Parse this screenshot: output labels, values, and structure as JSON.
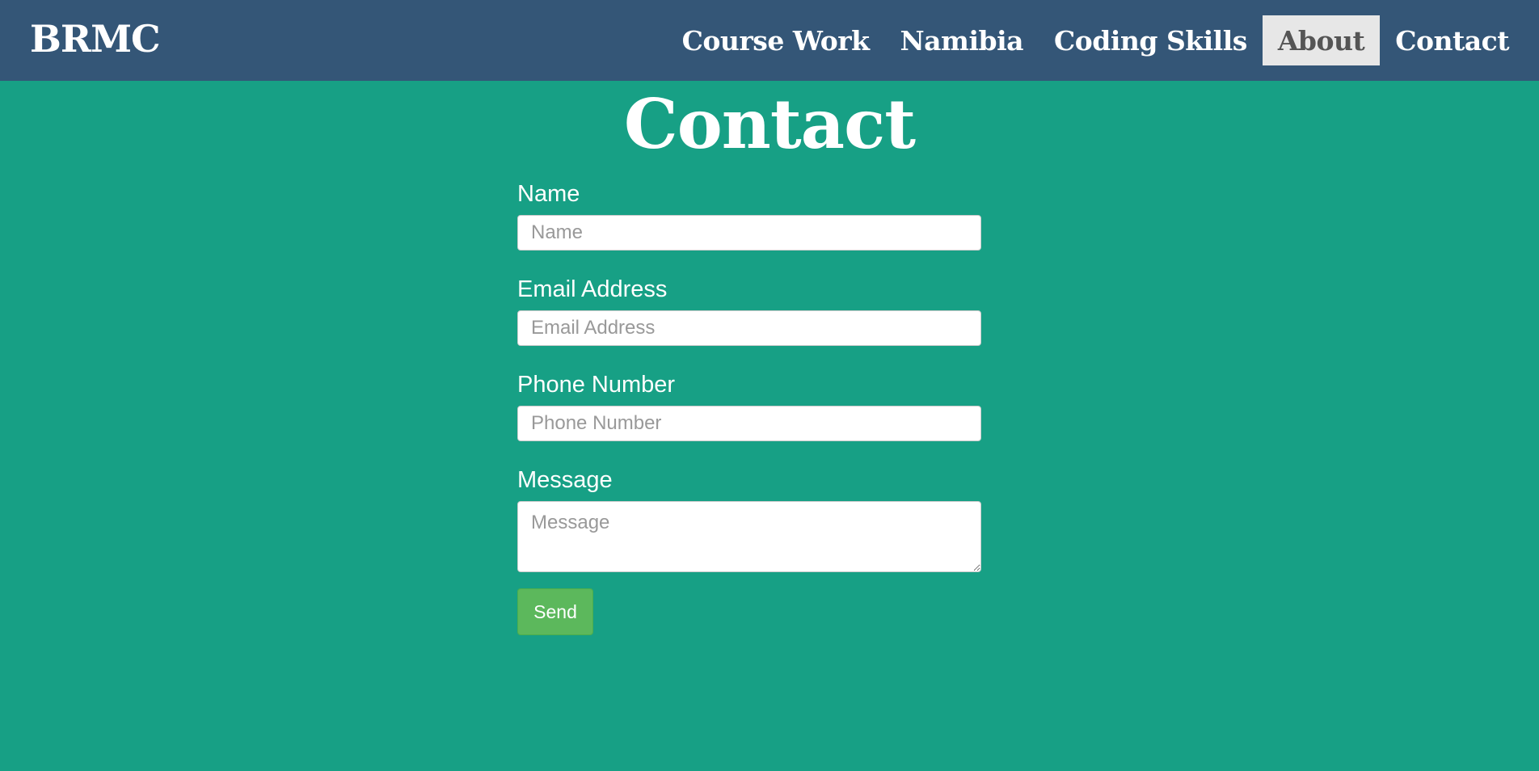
{
  "navbar": {
    "brand": "BRMC",
    "items": [
      {
        "label": "Course Work",
        "active": false
      },
      {
        "label": "Namibia",
        "active": false
      },
      {
        "label": "Coding Skills",
        "active": false
      },
      {
        "label": "About",
        "active": true
      },
      {
        "label": "Contact",
        "active": false
      }
    ]
  },
  "page": {
    "title": "Contact"
  },
  "form": {
    "name": {
      "label": "Name",
      "placeholder": "Name",
      "value": ""
    },
    "email": {
      "label": "Email Address",
      "placeholder": "Email Address",
      "value": ""
    },
    "phone": {
      "label": "Phone Number",
      "placeholder": "Phone Number",
      "value": ""
    },
    "message": {
      "label": "Message",
      "placeholder": "Message",
      "value": ""
    },
    "send_label": "Send"
  },
  "colors": {
    "navbar_bg": "#345677",
    "page_bg": "#17a085",
    "active_nav_bg": "#e7e7e7",
    "send_button": "#5cb85c"
  }
}
